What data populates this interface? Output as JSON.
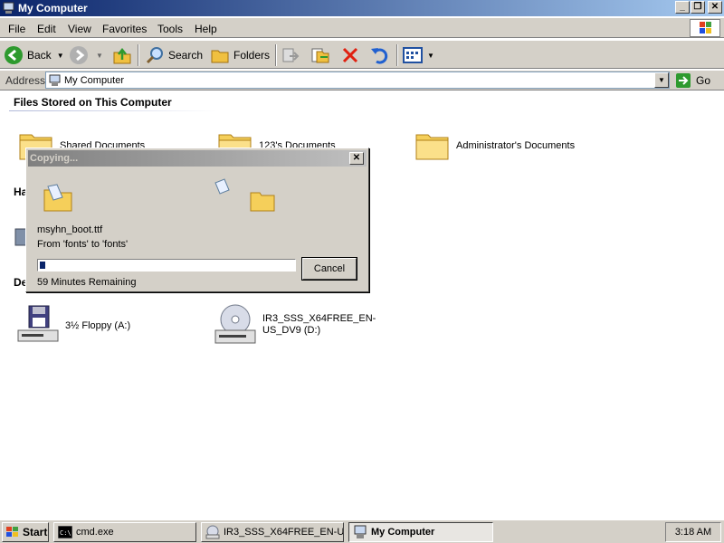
{
  "window": {
    "title": "My Computer"
  },
  "menu": [
    "File",
    "Edit",
    "View",
    "Favorites",
    "Tools",
    "Help"
  ],
  "toolbar": {
    "back": "Back",
    "search": "Search",
    "folders": "Folders"
  },
  "address": {
    "label": "Address",
    "value": "My Computer",
    "go": "Go"
  },
  "content": {
    "group_files": "Files Stored on This Computer",
    "files": [
      "Shared Documents",
      "123's Documents",
      "Administrator's Documents"
    ],
    "group_hard_disks_partial": "Ha",
    "group_devices_partial": "De",
    "devices": [
      "3½ Floppy (A:)",
      "IR3_SSS_X64FREE_EN-US_DV9 (D:)"
    ]
  },
  "dialog": {
    "title": "Copying...",
    "filename": "msyhn_boot.ttf",
    "from_to": "From 'fonts' to 'fonts'",
    "progress": 0.02,
    "remaining": "59 Minutes Remaining",
    "cancel": "Cancel"
  },
  "taskbar": {
    "start": "Start",
    "tasks": [
      "cmd.exe",
      "IR3_SSS_X64FREE_EN-U...",
      "My Computer"
    ],
    "active_task": "My Computer",
    "clock": "3:18 AM"
  }
}
